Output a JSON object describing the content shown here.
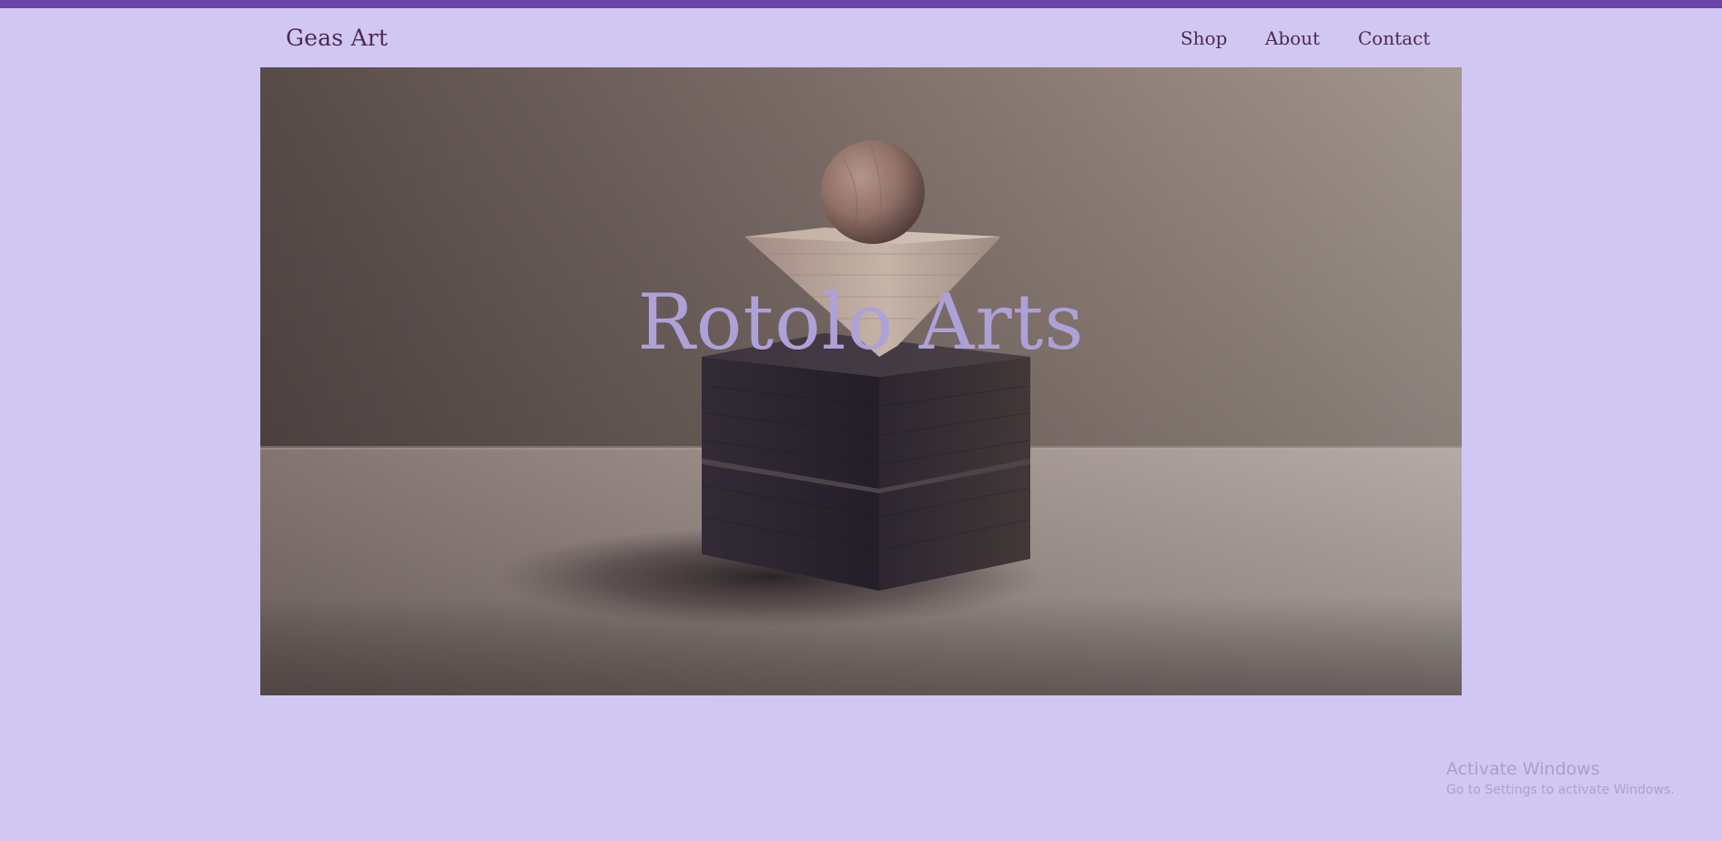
{
  "header": {
    "logo_text": "Geas Art",
    "nav": [
      {
        "label": "Shop"
      },
      {
        "label": "About"
      },
      {
        "label": "Contact"
      }
    ]
  },
  "hero": {
    "title": "Rotolo Arts"
  },
  "windows_watermark": {
    "title": "Activate Windows",
    "subtitle": "Go to Settings to activate Windows."
  },
  "colors": {
    "background": "#d1c7f3",
    "top_strip": "#6b44a6",
    "header_text": "#4c2a52",
    "hero_title": "#ada1d8"
  }
}
